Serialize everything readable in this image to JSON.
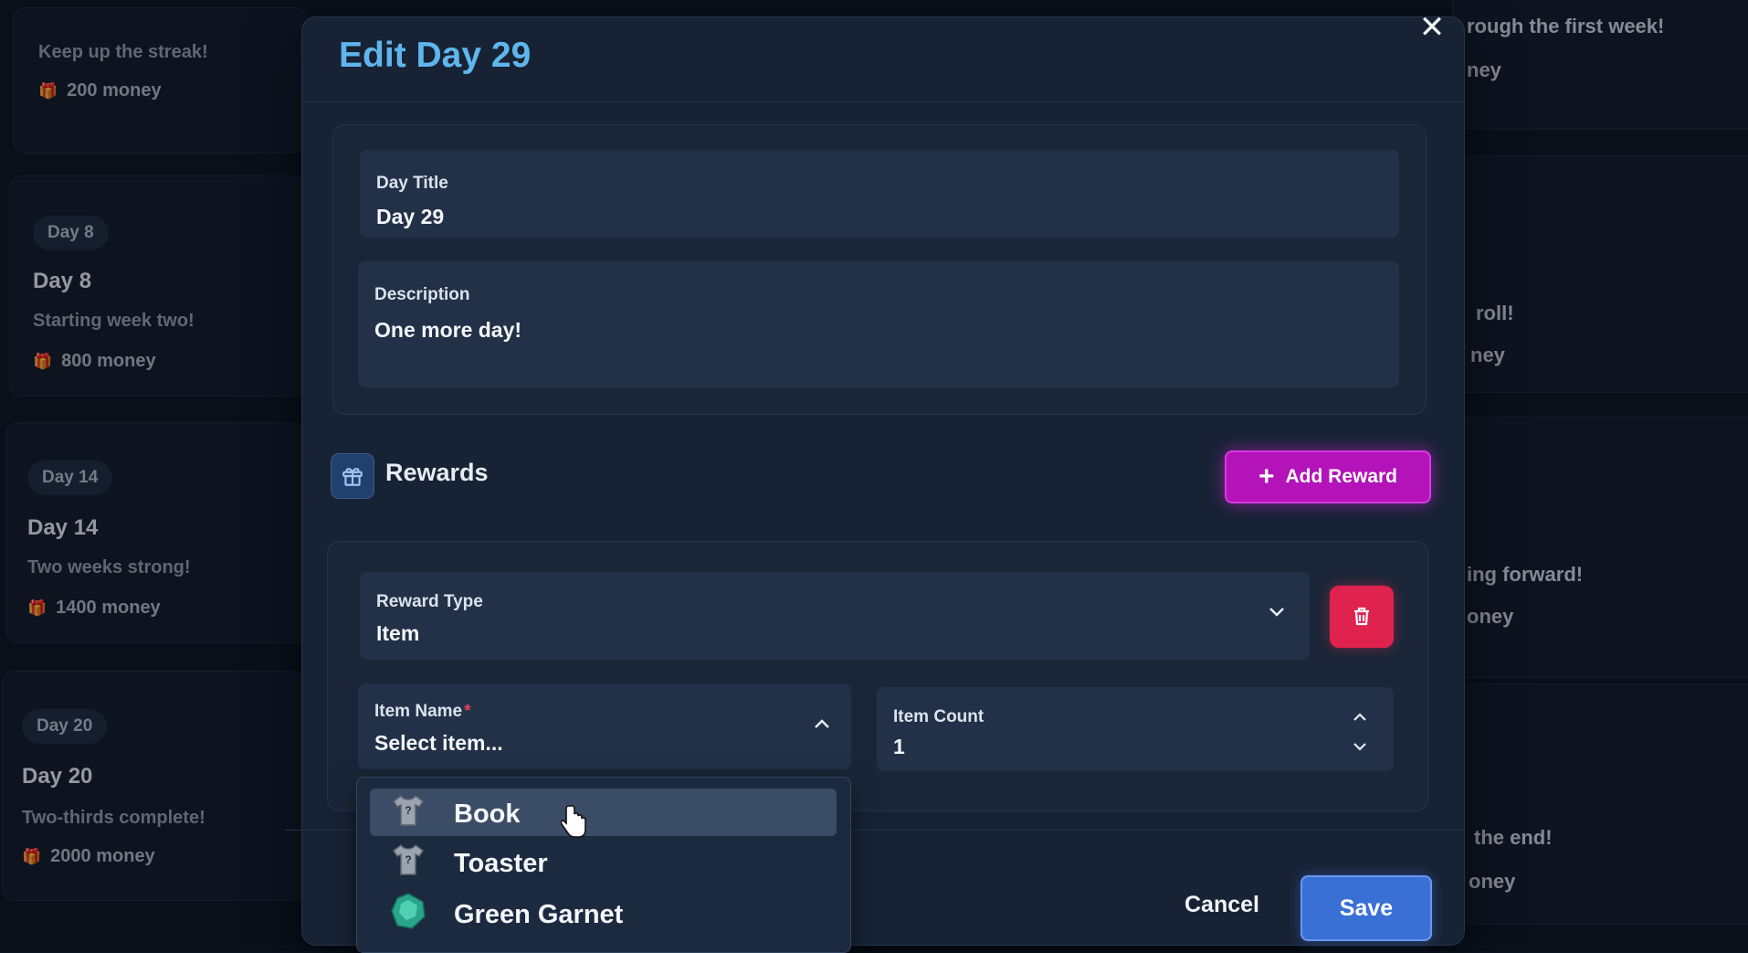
{
  "background_cards": {
    "top_left": {
      "desc": "Keep up the streak!",
      "money": "200 money"
    },
    "cards": [
      {
        "badge": "Day 8",
        "title": "Day 8",
        "desc": "Starting week two!",
        "money": "800 money"
      },
      {
        "badge": "Day 14",
        "title": "Day 14",
        "desc": "Two weeks strong!",
        "money": "1400 money"
      },
      {
        "badge": "Day 20",
        "title": "Day 20",
        "desc": "Two-thirds complete!",
        "money": "2000 money"
      }
    ],
    "right": [
      {
        "desc": "rough the first week!",
        "money": "ney"
      },
      {
        "desc": "roll!",
        "money": "ney"
      },
      {
        "desc": "ing forward!",
        "money": "oney"
      },
      {
        "desc": "the end!",
        "money": "oney"
      }
    ]
  },
  "modal": {
    "title": "Edit Day 29",
    "close": "✕",
    "day_title": {
      "label": "Day Title",
      "value": "Day 29"
    },
    "description": {
      "label": "Description",
      "value": "One more day!"
    },
    "rewards": {
      "title": "Rewards",
      "add_label": "Add Reward",
      "reward_type": {
        "label": "Reward Type",
        "value": "Item"
      },
      "item_name": {
        "label": "Item Name",
        "required_mark": "*",
        "value": "Select item..."
      },
      "item_count": {
        "label": "Item Count",
        "value": "1"
      }
    },
    "footer": {
      "cancel_label": "Cancel",
      "save_label": "Save"
    }
  },
  "dropdown": {
    "options": [
      {
        "label": "Book",
        "icon": "shirt-icon",
        "highlighted": true
      },
      {
        "label": "Toaster",
        "icon": "shirt-icon",
        "highlighted": false
      },
      {
        "label": "Green Garnet",
        "icon": "gem-icon",
        "highlighted": false
      }
    ]
  },
  "colors": {
    "title_accent": "#5fb6ec",
    "add_reward": "#b313b8",
    "delete": "#e0224f",
    "save": "#3a6fd6"
  }
}
